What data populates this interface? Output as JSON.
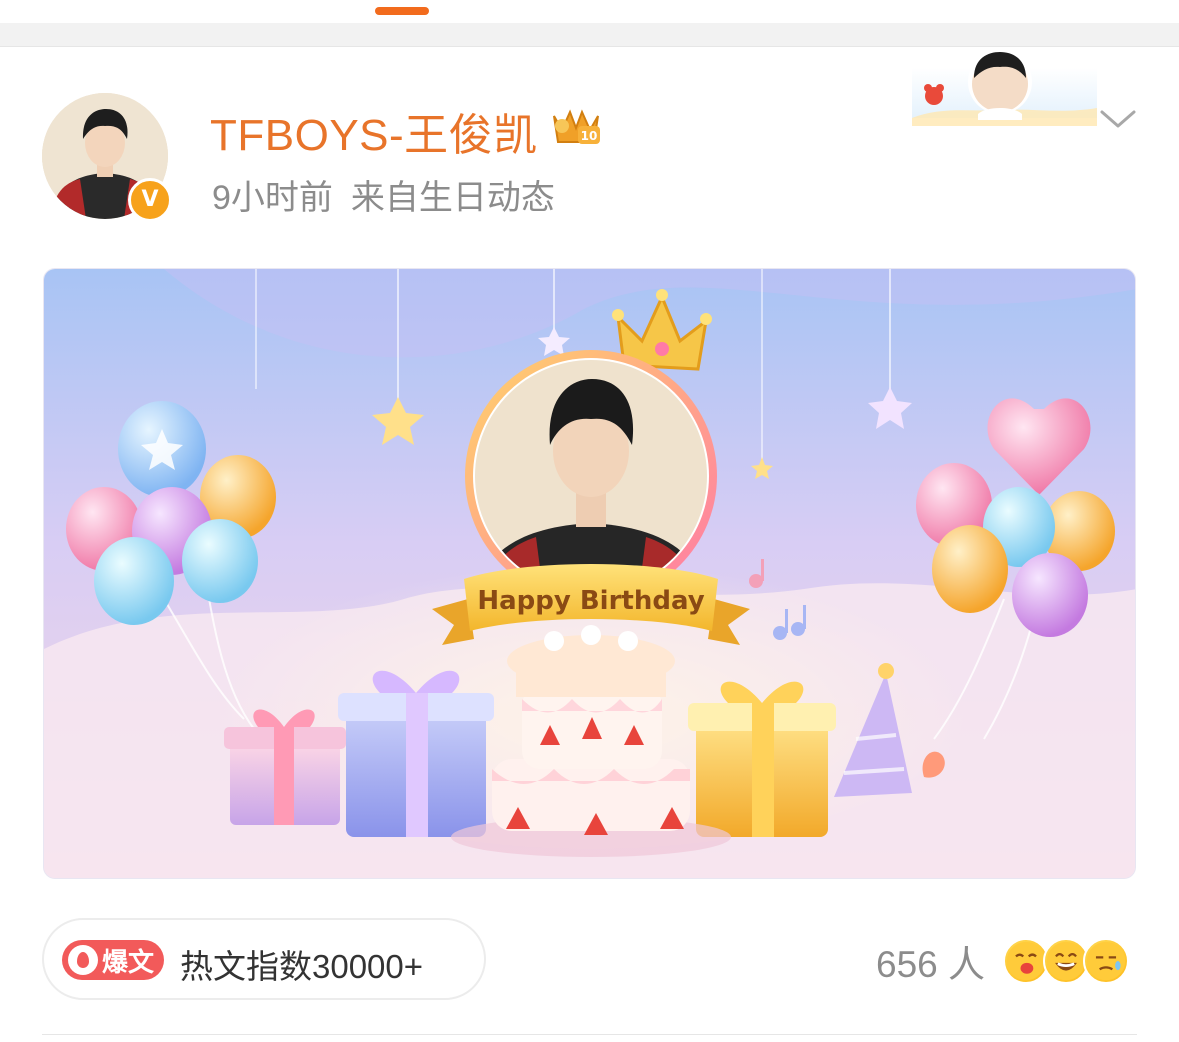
{
  "post": {
    "author": "TFBOYS-王俊凯",
    "time": "9小时前",
    "source": "来自生日动态",
    "badges": {
      "verified": "V",
      "member_level": "10"
    }
  },
  "banner": {
    "ribbon_text": "Happy Birthday"
  },
  "footer": {
    "hot_tag": "爆文",
    "hot_index": "热文指数30000+",
    "reaction_count": "656 人"
  },
  "icons": [
    "verified-v-icon",
    "member-crown-badge-icon",
    "chevron-down-icon",
    "flame-icon",
    "emoji-face-icons"
  ],
  "colors": {
    "username": "#e8742a",
    "accent_tab": "#f26b1d",
    "verified_badge": "#f7a21b",
    "hot_tag_bg": "#f25a5a",
    "meta_text": "#8c8c8c"
  }
}
